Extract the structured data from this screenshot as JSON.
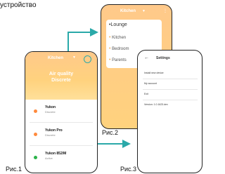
{
  "heading_text": "устройство",
  "captions": {
    "fig1": "Рис.1",
    "fig2": "Рис.2",
    "fig3": "Рис.3"
  },
  "colors": {
    "arrow": "#2aa9a9",
    "header_gradient_top": "#ffc98a",
    "header_gradient_bottom": "#ffe09a"
  },
  "screen1": {
    "room_title": "Kitchen",
    "air_quality_line1": "Air quality",
    "air_quality_line2": "Discrete",
    "devices": [
      {
        "name": "Yukon",
        "status": "Discrete",
        "dot_color": "#ff8a3d"
      },
      {
        "name": "Yukon Pro",
        "status": "Discrete",
        "dot_color": "#ff8a3d"
      },
      {
        "name": "Yukon 852/M",
        "status": "Active",
        "dot_color": "#2bb34a"
      }
    ]
  },
  "screen2": {
    "room_title": "Kitchen",
    "rooms": [
      "Lounge",
      "Kitchen",
      "Bedroom",
      "Parents"
    ]
  },
  "screen3": {
    "title": "Settings",
    "rows": [
      "Install new device",
      "My account",
      "Exit",
      "Version: 1.0.1623.dev"
    ]
  }
}
